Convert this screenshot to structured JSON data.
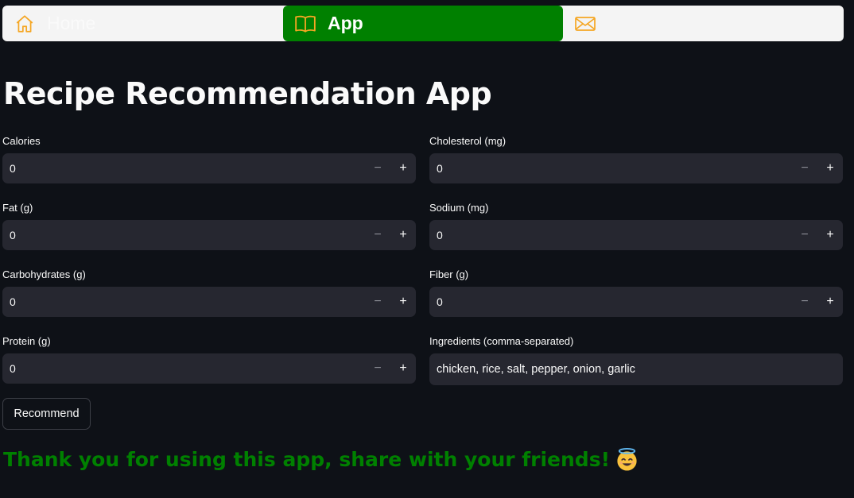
{
  "nav": {
    "items": [
      {
        "label": "Home",
        "icon": "house-icon",
        "active": false
      },
      {
        "label": "App",
        "icon": "book-icon",
        "active": true
      },
      {
        "label": "",
        "icon": "envelope-icon",
        "active": false
      }
    ],
    "active_color": "#008000",
    "icon_color": "#f5a623"
  },
  "page": {
    "title": "Recipe Recommendation App"
  },
  "form": {
    "calories": {
      "label": "Calories",
      "value": "0"
    },
    "cholesterol": {
      "label": "Cholesterol (mg)",
      "value": "0"
    },
    "fat": {
      "label": "Fat (g)",
      "value": "0"
    },
    "sodium": {
      "label": "Sodium (mg)",
      "value": "0"
    },
    "carbohydrates": {
      "label": "Carbohydrates (g)",
      "value": "0"
    },
    "fiber": {
      "label": "Fiber (g)",
      "value": "0"
    },
    "protein": {
      "label": "Protein (g)",
      "value": "0"
    },
    "ingredients": {
      "label": "Ingredients (comma-separated)",
      "value": "chicken, rice, salt, pepper, onion, garlic"
    },
    "stepper": {
      "minus": "−",
      "plus": "+"
    }
  },
  "actions": {
    "recommend_label": "Recommend"
  },
  "footer": {
    "thanks_text": "Thank you for using this app, share with your friends!",
    "emoji": "smiling-face-with-halo-icon",
    "text_color": "#008000"
  }
}
